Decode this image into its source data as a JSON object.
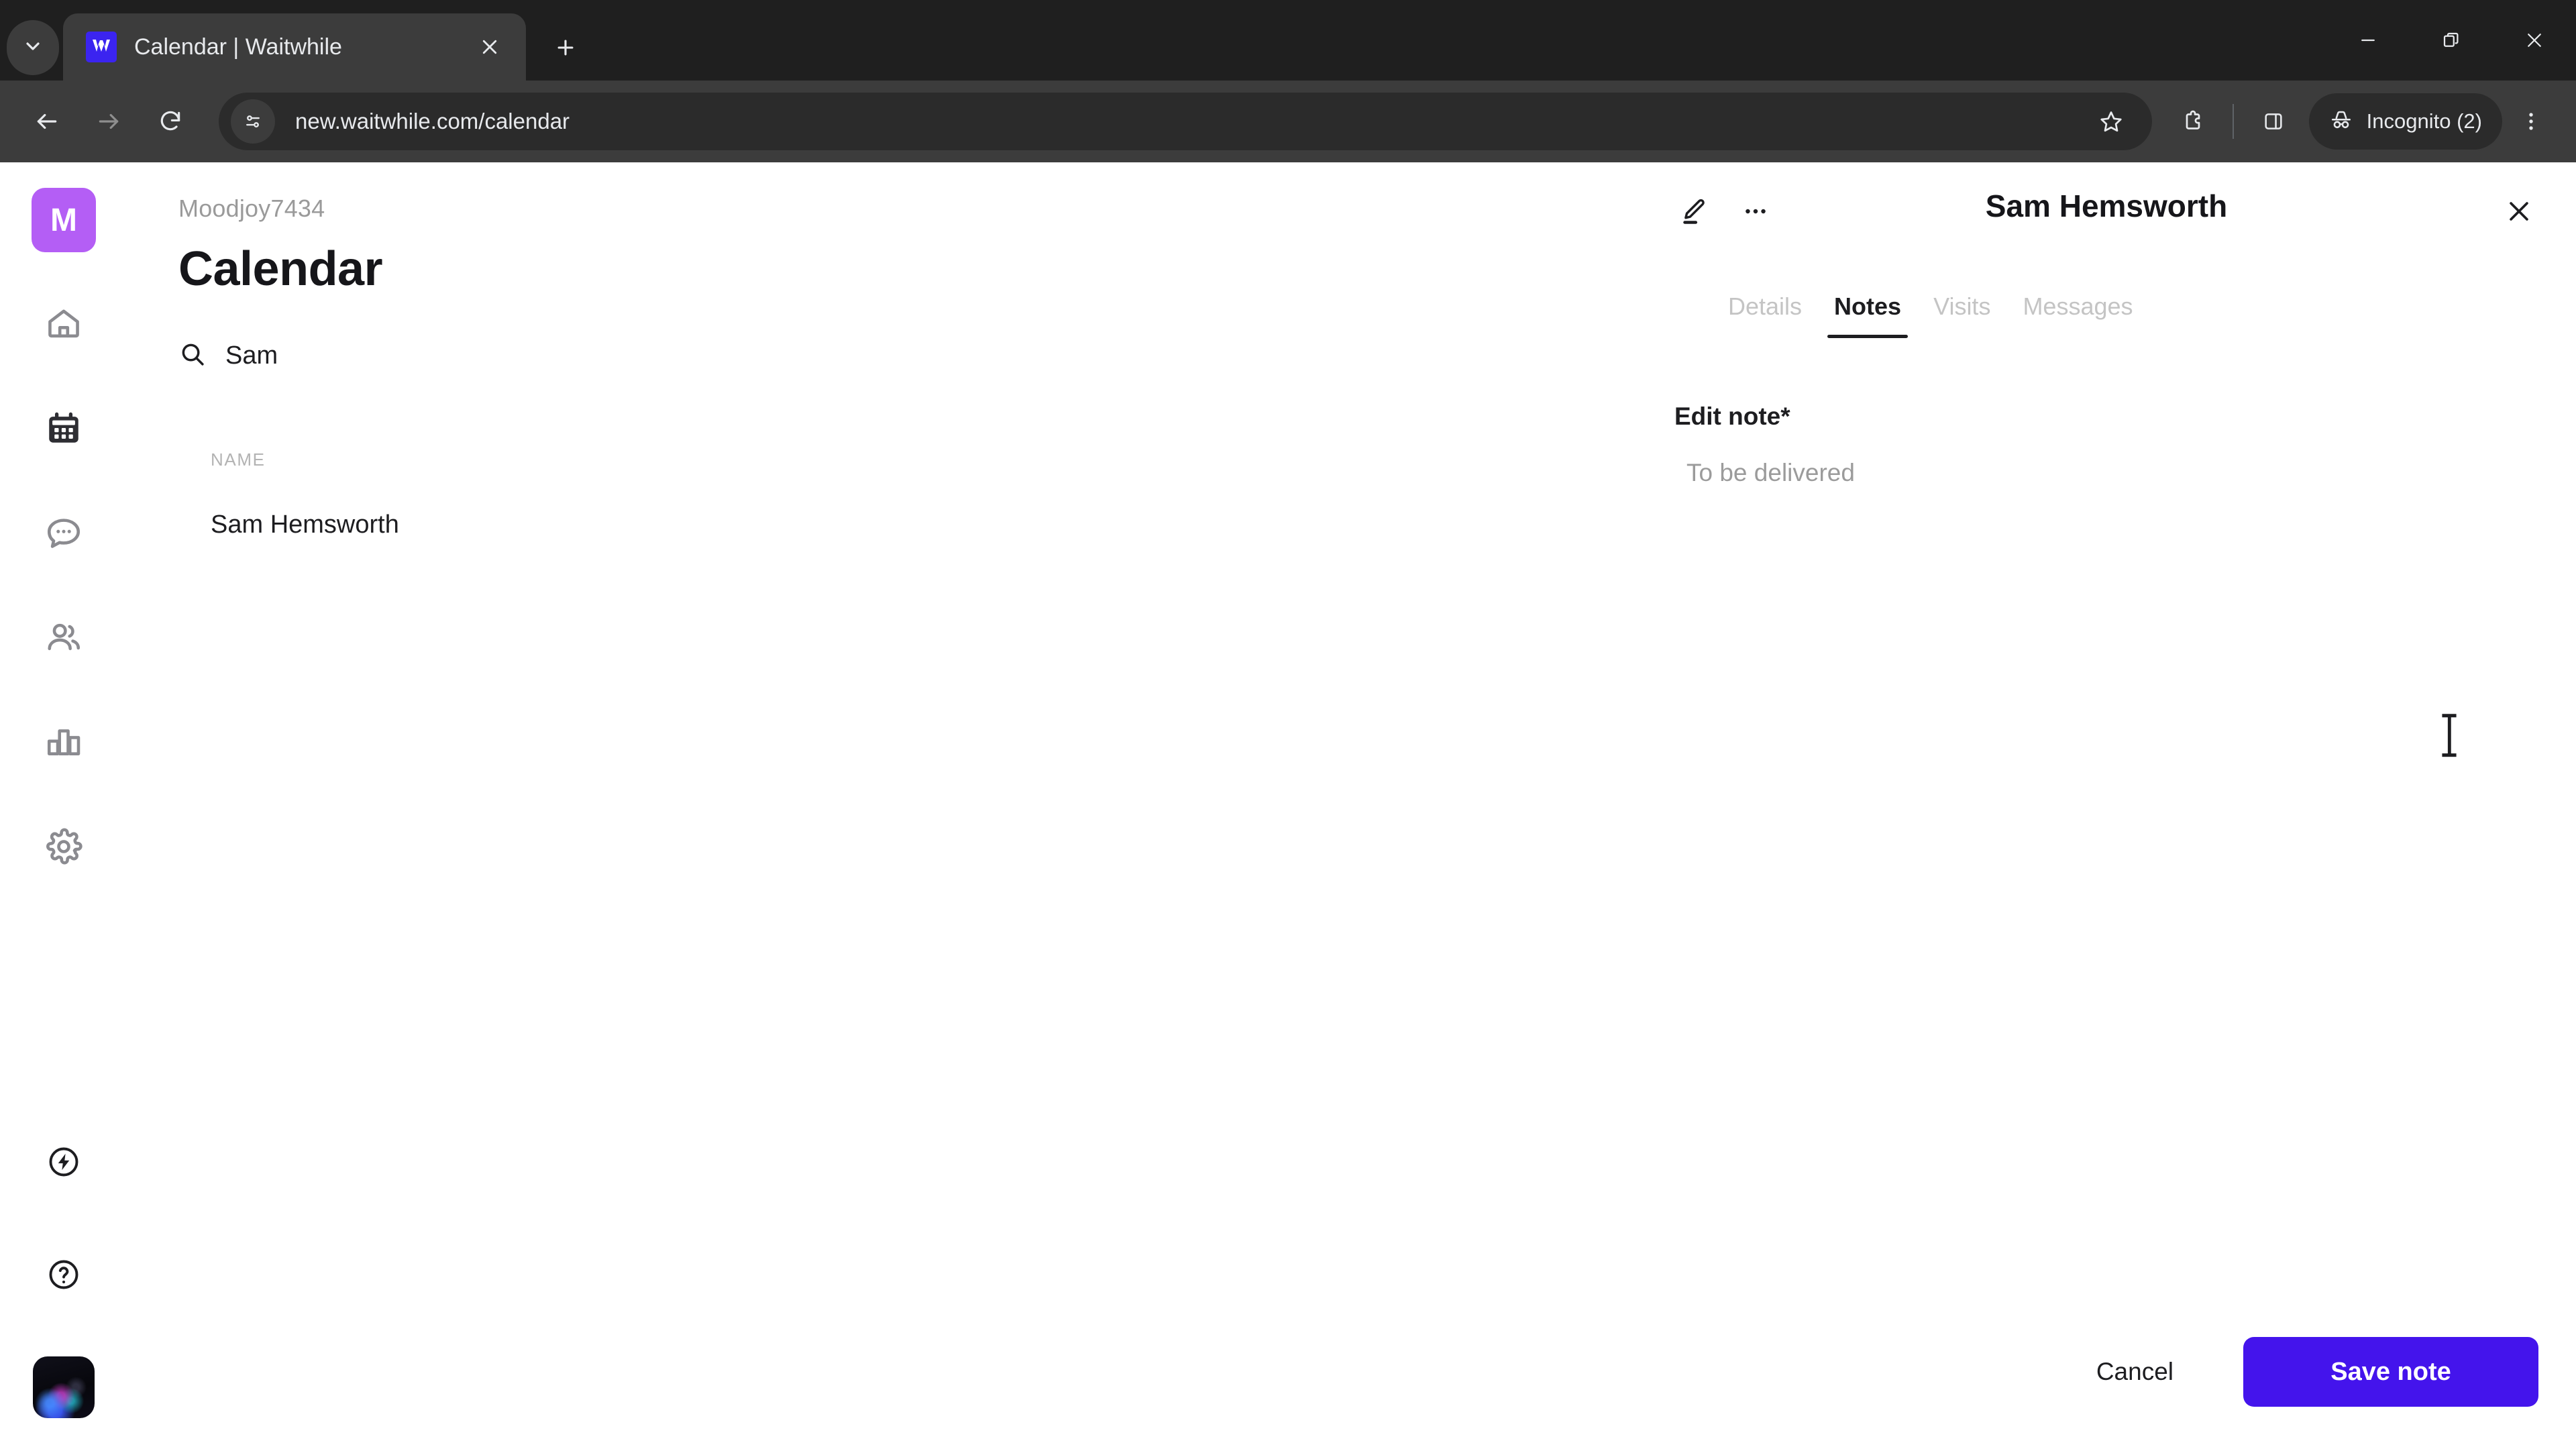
{
  "browser": {
    "tab_search_icon": "chevron-down-icon",
    "tab": {
      "title": "Calendar | Waitwhile",
      "favicon_letter": "W",
      "favicon_color": "#3b24f0",
      "close_icon": "close-icon"
    },
    "new_tab_label": "+",
    "window_controls": {
      "minimize": "minimize-icon",
      "restore": "restore-icon",
      "close": "close-icon"
    },
    "toolbar": {
      "back_icon": "back-arrow-icon",
      "forward_icon": "forward-arrow-icon",
      "reload_icon": "reload-icon",
      "site_info_icon": "site-settings-icon",
      "url": "new.waitwhile.com/calendar",
      "bookmark_icon": "star-icon",
      "extensions_icon": "extensions-icon",
      "side_panel_icon": "side-panel-icon",
      "profile_icon": "incognito-icon",
      "profile_label": "Incognito (2)",
      "menu_icon": "three-dots-vertical-icon"
    }
  },
  "sidebar": {
    "workspace_initial": "M",
    "workspace_color": "#b45ef5",
    "items": [
      {
        "icon": "home-icon",
        "name": "home",
        "active": false
      },
      {
        "icon": "calendar-icon",
        "name": "calendar",
        "active": true
      },
      {
        "icon": "chat-bubble-icon",
        "name": "messages",
        "active": false
      },
      {
        "icon": "people-icon",
        "name": "customers",
        "active": false
      },
      {
        "icon": "bar-chart-icon",
        "name": "analytics",
        "active": false
      },
      {
        "icon": "gear-icon",
        "name": "settings",
        "active": false
      }
    ],
    "bottom_items": [
      {
        "icon": "bolt-circle-icon",
        "name": "whats-new"
      },
      {
        "icon": "question-circle-icon",
        "name": "help"
      }
    ],
    "user_avatar": "user-avatar-photo"
  },
  "main": {
    "breadcrumb": "Moodjoy7434",
    "title": "Calendar",
    "search": {
      "icon": "search-icon",
      "value": "Sam",
      "placeholder": "Search"
    },
    "table": {
      "columns": [
        "NAME"
      ],
      "rows": [
        {
          "name": "Sam Hemsworth"
        }
      ]
    }
  },
  "panel": {
    "edit_icon": "pencil-edit-icon",
    "more_icon": "three-dots-horizontal-icon",
    "title": "Sam Hemsworth",
    "close_icon": "close-icon",
    "tabs": [
      {
        "label": "Details",
        "active": false
      },
      {
        "label": "Notes",
        "active": true
      },
      {
        "label": "Visits",
        "active": false
      },
      {
        "label": "Messages",
        "active": false
      }
    ],
    "note_form": {
      "label": "Edit note",
      "required_mark": "*",
      "value": "",
      "placeholder": "To be delivered"
    },
    "footer": {
      "cancel_label": "Cancel",
      "save_label": "Save note",
      "save_color": "#4414ec"
    }
  }
}
